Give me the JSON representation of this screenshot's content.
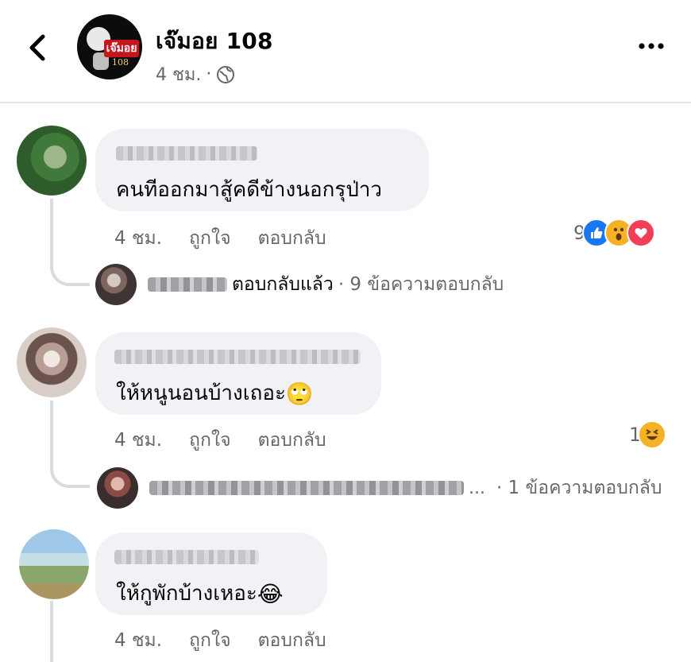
{
  "header": {
    "page_name": "เจ๊มอย 108",
    "time": "4 ชม.",
    "separator": "·",
    "avatar_badge": "เจ๊มอย",
    "avatar_number": "108",
    "icons": {
      "back": "chevron-left-icon",
      "privacy": "globe-icon",
      "more": "more-dots-icon"
    }
  },
  "comments": [
    {
      "author_blurred": true,
      "text": "คนทีออกมาสู้คดีข้างนอกรุป่าว",
      "text_emoji": "",
      "time": "4 ชม.",
      "like_label": "ถูกใจ",
      "reply_label": "ตอบกลับ",
      "reaction_count": "9",
      "reactions": [
        "like",
        "wow",
        "love"
      ],
      "reply_preview": {
        "text": "ตอบกลับแล้ว",
        "count_text": "· 9 ข้อความตอบกลับ",
        "ellipsis": ""
      }
    },
    {
      "author_blurred": true,
      "text": "ให้หนูนอนบ้างเถอะ",
      "text_emoji": "🙄",
      "time": "4 ชม.",
      "like_label": "ถูกใจ",
      "reply_label": "ตอบกลับ",
      "reaction_count": "1",
      "reactions": [
        "haha"
      ],
      "reply_preview": {
        "text": "",
        "count_text": "· 1 ข้อความตอบกลับ",
        "ellipsis": "..."
      }
    },
    {
      "author_blurred": true,
      "text": "ให้กูพักบ้างเหอะ",
      "text_emoji": "😂",
      "time": "4 ชม.",
      "like_label": "ถูกใจ",
      "reply_label": "ตอบกลับ"
    }
  ],
  "colors": {
    "bubble": "#f0f2f5",
    "meta_text": "#65676b",
    "like_blue": "#1877f2",
    "love_red": "#f33e58",
    "emoji_yellow": "#f7b125"
  }
}
